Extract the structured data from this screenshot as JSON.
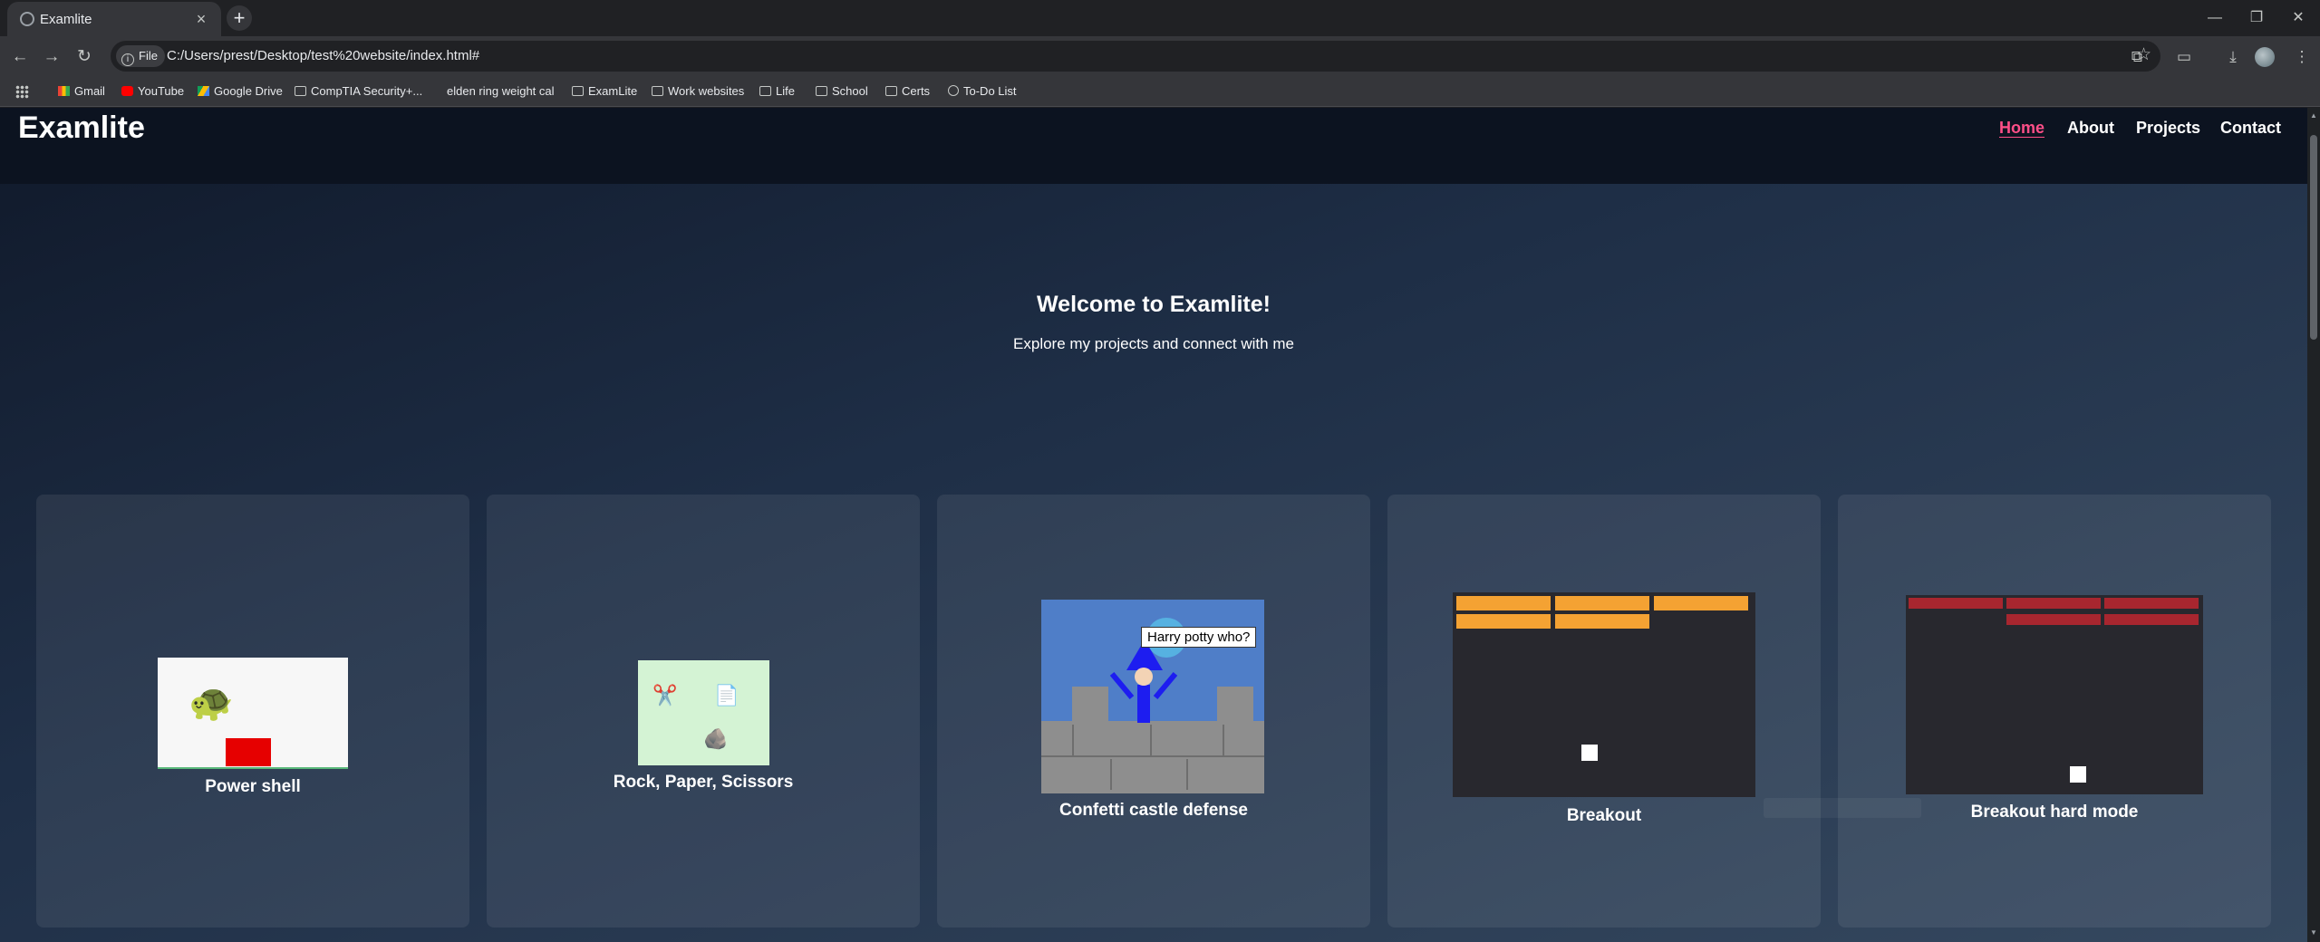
{
  "browser": {
    "tab_title": "Examlite",
    "url": "C:/Users/prest/Desktop/test%20website/index.html#",
    "scheme_chip": "File",
    "bookmarks": [
      "Gmail",
      "YouTube",
      "Google Drive",
      "CompTIA Security+...",
      "elden ring weight cal",
      "ExamLite",
      "Work websites",
      "Life",
      "School",
      "Certs",
      "To-Do List"
    ]
  },
  "site": {
    "logo": "Examlite",
    "nav": [
      "Home",
      "About",
      "Projects",
      "Contact"
    ],
    "active_nav": "Home",
    "hero_title": "Welcome to Examlite!",
    "hero_subtitle": "Explore my projects and connect with me",
    "projects": [
      {
        "title": "Power shell"
      },
      {
        "title": "Rock, Paper, Scissors"
      },
      {
        "title": "Confetti castle defense",
        "speech": "Harry potty who?"
      },
      {
        "title": "Breakout"
      },
      {
        "title": "Breakout hard mode"
      }
    ]
  },
  "colors": {
    "accent_nav": "#ff4f88",
    "breakout_bricks": "#f4a233",
    "breakout_hard_bricks": "#a8262f"
  }
}
